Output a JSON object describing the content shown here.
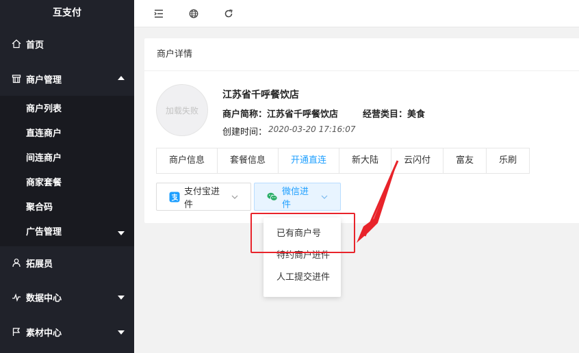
{
  "app": {
    "title": "互支付"
  },
  "sidebar": {
    "items": [
      {
        "label": "首页",
        "icon": "home-icon"
      },
      {
        "label": "商户管理",
        "icon": "store-icon",
        "expanded": true
      },
      {
        "label": "拓展员",
        "icon": "user-icon"
      },
      {
        "label": "数据中心",
        "icon": "chart-line-icon"
      },
      {
        "label": "素材中心",
        "icon": "flag-icon"
      }
    ],
    "submenu": [
      {
        "label": "商户列表"
      },
      {
        "label": "直连商户"
      },
      {
        "label": "间连商户"
      },
      {
        "label": "商家套餐"
      },
      {
        "label": "聚合码"
      },
      {
        "label": "广告管理"
      }
    ]
  },
  "topbar": {
    "icons": [
      "menu-fold-icon",
      "globe-icon",
      "refresh-icon"
    ]
  },
  "card": {
    "title": "商户详情",
    "avatar_text": "加载失败",
    "merchant_name": "江苏省千呼餐饮店",
    "short_name_label": "商户简称：",
    "short_name_value": "江苏省千呼餐饮店",
    "category_label": "经营类目：",
    "category_value": "美食",
    "created_label": "创建时间：",
    "created_value": "2020-03-20 17:16:07",
    "tabs": [
      "商户信息",
      "套餐信息",
      "开通直连",
      "新大陆",
      "云闪付",
      "富友",
      "乐刷"
    ],
    "active_tab": "开通直连",
    "alipay_button": "支付宝进件",
    "wechat_button": "微信进件"
  },
  "dropdown": {
    "options": [
      "已有商户号",
      "特约商户进件",
      "人工提交进件"
    ]
  },
  "colors": {
    "sidebar_bg": "#20222a",
    "submenu_bg": "#191a20",
    "accent": "#1e9fff",
    "annotation_red": "#e8232a"
  }
}
